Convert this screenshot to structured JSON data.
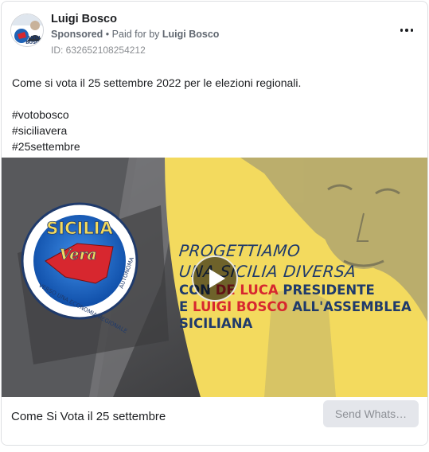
{
  "post": {
    "page_name": "Luigi Bosco",
    "sponsored_label": "Sponsored",
    "separator": "•",
    "paid_for_prefix": "Paid for by",
    "paid_for_name": "Luigi Bosco",
    "library_id": "ID: 632652108254212",
    "text_line_1": "Come si vota il 25 settembre 2022 per le elezioni regionali.",
    "hashtags": [
      "#votobosco",
      "#siciliavera",
      "#25settembre"
    ]
  },
  "media": {
    "logo_top_text": "SICILIA",
    "logo_script_text": "Vera",
    "logo_ring_left": "VERSO UNA ECONOMIA REGIONALE",
    "logo_ring_right": "AUTONOMA",
    "headline_script_1": "PROGETTIAMO",
    "headline_script_2": "UNA SICILIA DIVERSA",
    "headline_line_1_a": "CON ",
    "headline_line_1_b": "DE LUCA",
    "headline_line_1_c": " PRESIDENTE",
    "headline_line_2_a": "E ",
    "headline_line_2_b": "LUIGI BOSCO",
    "headline_line_2_c": " ALL'ASSEMBLEA",
    "headline_line_3": "SICILIANA",
    "avatar_text_top": "LUIGI",
    "avatar_text_bottom": "BOSCO"
  },
  "footer": {
    "title": "Come Si Vota il 25 settembre",
    "cta_label": "Send Whats…"
  },
  "colors": {
    "brand_blue": "#1f3a6b",
    "accent_red": "#d7272f",
    "poster_yellow": "#f3da5e"
  },
  "icons": {
    "more": "more-horizontal-icon",
    "play": "play-icon"
  }
}
